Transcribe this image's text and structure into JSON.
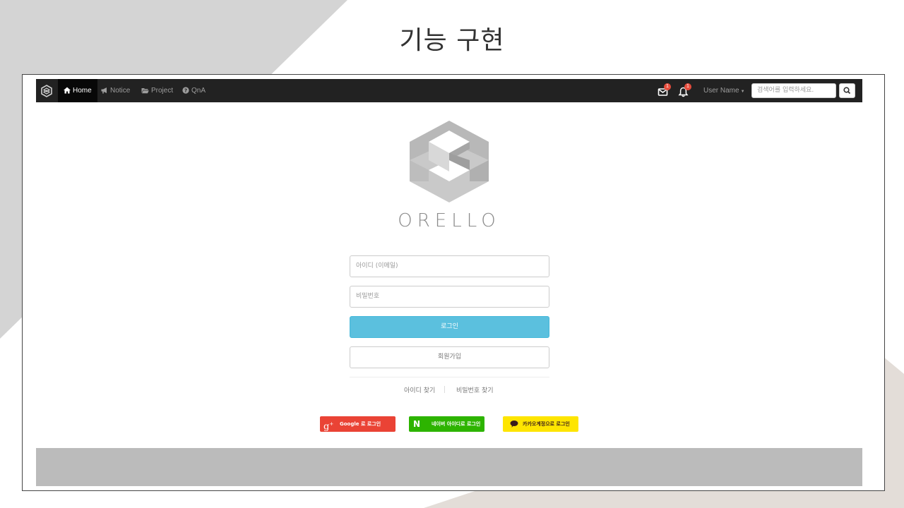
{
  "slide": {
    "title": "기능 구현"
  },
  "navbar": {
    "home": "Home",
    "notice": "Notice",
    "project": "Project",
    "qna": "QnA",
    "mail_count": "1",
    "alarm_count": "1",
    "user_menu": "User Name",
    "search_placeholder": "검색어를 입력하세요."
  },
  "login": {
    "brand": "ORELLO",
    "id_placeholder": "아이디 (이메일)",
    "password_placeholder": "비밀번호",
    "login_button": "로그인",
    "signup_button": "회원가입",
    "find_id": "아이디 찾기",
    "find_password": "비밀번호 찾기"
  },
  "social": {
    "google": "Google 로 로그인",
    "naver": "네이버 아이디로 로그인",
    "kakao": "카카오계정으로 로그인"
  },
  "colors": {
    "navbar": "#222222",
    "login_button": "#5bc0de",
    "google": "#ea4335",
    "naver": "#2db400",
    "kakao": "#fee500",
    "badge": "#e74c3c"
  },
  "icons": [
    "orello-logo-icon",
    "home-icon",
    "bullhorn-icon",
    "folder-open-icon",
    "question-circle-icon",
    "envelope-icon",
    "bell-icon",
    "search-icon",
    "google-plus-icon",
    "naver-icon",
    "kakao-talk-icon"
  ]
}
